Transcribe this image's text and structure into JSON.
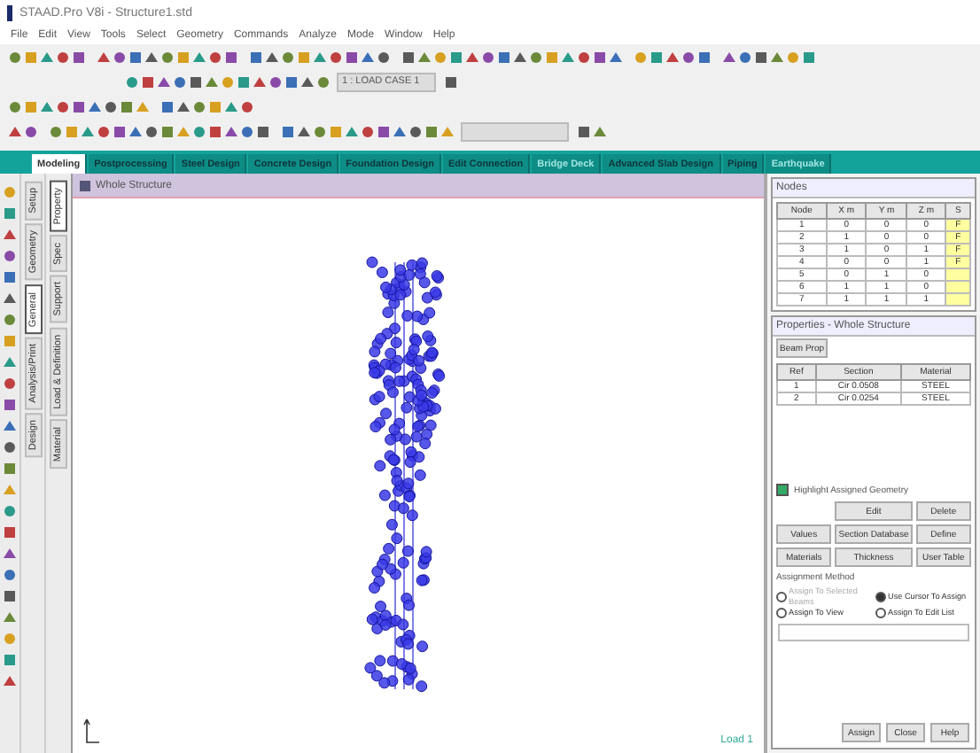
{
  "window": {
    "title": "STAAD.Pro V8i - Structure1.std"
  },
  "menu": [
    "File",
    "Edit",
    "View",
    "Tools",
    "Select",
    "Geometry",
    "Commands",
    "Analyze",
    "Mode",
    "Window",
    "Help"
  ],
  "toolbar": {
    "load_dropdown": "1 : LOAD CASE 1"
  },
  "page_tabs": [
    {
      "label": "Modeling",
      "selected": true,
      "disabled": false
    },
    {
      "label": "Postprocessing",
      "selected": false,
      "disabled": false
    },
    {
      "label": "Steel Design",
      "selected": false,
      "disabled": false
    },
    {
      "label": "Concrete Design",
      "selected": false,
      "disabled": false
    },
    {
      "label": "Foundation Design",
      "selected": false,
      "disabled": false
    },
    {
      "label": "Edit Connection",
      "selected": false,
      "disabled": false
    },
    {
      "label": "Bridge Deck",
      "selected": false,
      "disabled": true
    },
    {
      "label": "Advanced Slab Design",
      "selected": false,
      "disabled": false
    },
    {
      "label": "Piping",
      "selected": false,
      "disabled": false
    },
    {
      "label": "Earthquake",
      "selected": false,
      "disabled": true
    }
  ],
  "side_tabs": [
    {
      "label": "Setup",
      "selected": false
    },
    {
      "label": "Geometry",
      "selected": false
    },
    {
      "label": "General",
      "selected": true
    },
    {
      "label": "Analysis/Print",
      "selected": false
    },
    {
      "label": "Design",
      "selected": false
    }
  ],
  "sub_tabs": [
    {
      "label": "Property",
      "selected": true
    },
    {
      "label": "Spec",
      "selected": false
    },
    {
      "label": "Support",
      "selected": false
    },
    {
      "label": "Load & Definition",
      "selected": false
    },
    {
      "label": "Material",
      "selected": false
    }
  ],
  "viewport": {
    "title": "Whole Structure",
    "load_label": "Load 1"
  },
  "nodes_table": {
    "title": "Nodes",
    "columns": [
      "Node",
      "X m",
      "Y m",
      "Z m",
      "S"
    ],
    "rows": [
      [
        "1",
        "0",
        "0",
        "0",
        "F"
      ],
      [
        "2",
        "1",
        "0",
        "0",
        "F"
      ],
      [
        "3",
        "1",
        "0",
        "1",
        "F"
      ],
      [
        "4",
        "0",
        "0",
        "1",
        "F"
      ],
      [
        "5",
        "0",
        "1",
        "0"
      ],
      [
        "6",
        "1",
        "1",
        "0"
      ],
      [
        "7",
        "1",
        "1",
        "1"
      ]
    ]
  },
  "properties": {
    "title": "Properties - Whole Structure",
    "section_tab": "Beam Prop",
    "columns": [
      "Ref",
      "Section",
      "Material"
    ],
    "rows": [
      [
        "1",
        "Cir 0.0508",
        "STEEL"
      ],
      [
        "2",
        "Cir 0.0254",
        "STEEL"
      ]
    ],
    "highlight": {
      "label": "Highlight Assigned Geometry",
      "checked": true
    },
    "buttons": [
      {
        "indented": true,
        "labels": [
          "Edit",
          "Delete"
        ]
      },
      {
        "indented": false,
        "labels": [
          "Values",
          "Section Database",
          "Define"
        ]
      },
      {
        "indented": false,
        "labels": [
          "Materials",
          "Thickness",
          "User Table"
        ]
      }
    ],
    "assignment_title": "Assignment Method",
    "methods": [
      {
        "label": "Assign To Selected Beams",
        "selected": false,
        "disabled": true
      },
      {
        "label": "Use Cursor To Assign",
        "selected": true,
        "disabled": false
      },
      {
        "label": "Assign To View",
        "selected": false,
        "disabled": false
      },
      {
        "label": "Assign To Edit List",
        "selected": false,
        "disabled": false
      }
    ],
    "actions": [
      "Assign",
      "Close",
      "Help"
    ]
  }
}
